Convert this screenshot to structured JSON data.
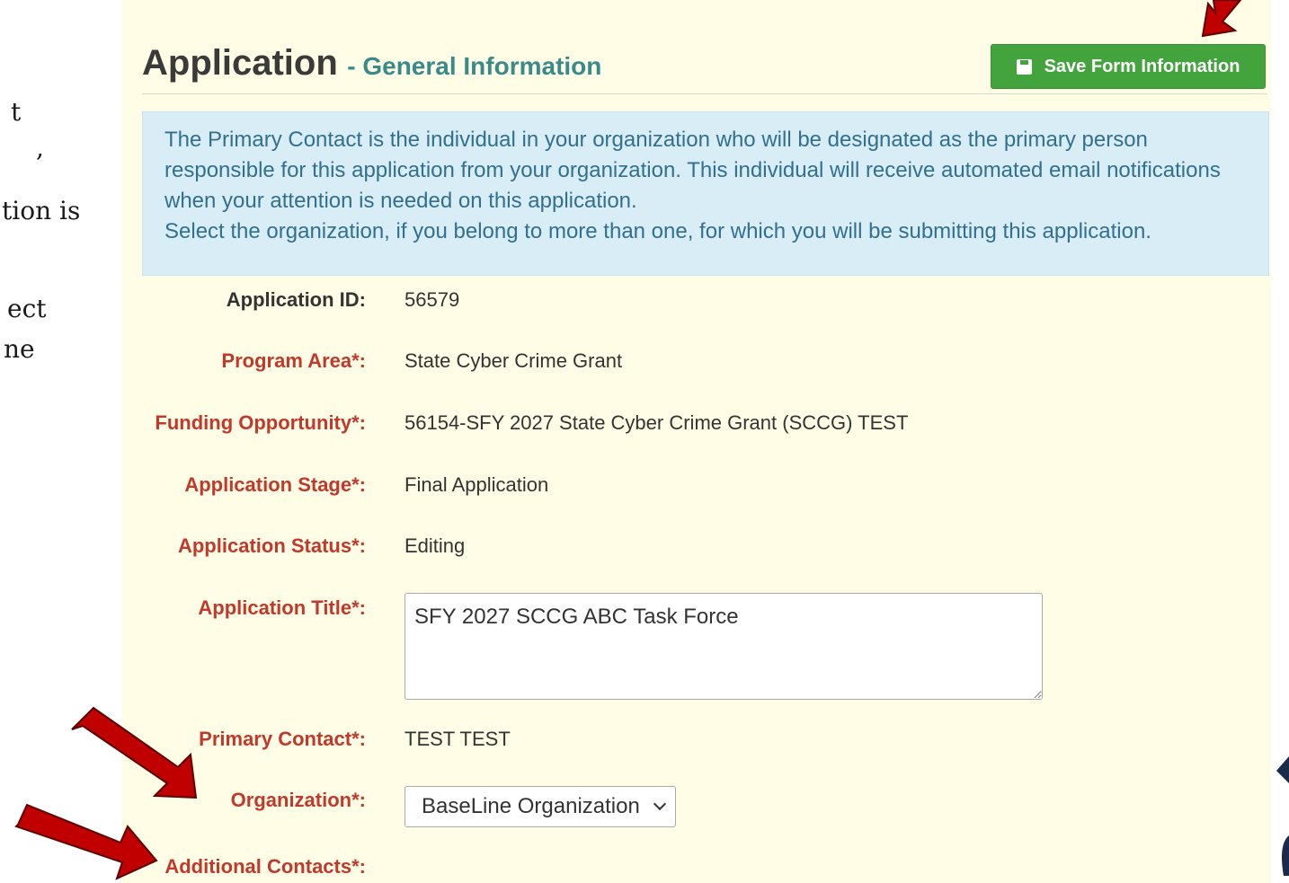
{
  "slide_fragments": [
    "t",
    ",",
    "tion is",
    "ect",
    "ne"
  ],
  "header": {
    "title": "Application",
    "subtitle": "- General Information",
    "save_label": "Save Form Information",
    "save_icon": "floppy-disk-icon"
  },
  "info": {
    "paragraph": "The Primary Contact is the individual in your organization who will be designated as the primary person responsible for this application from your organization. This individual will receive automated email notifications when your attention is needed on this application.",
    "paragraph2": "Select the organization, if you belong to more than one, for which you will be submitting this application."
  },
  "fields": {
    "application_id": {
      "label": "Application ID:",
      "value": "56579"
    },
    "program_area": {
      "label": "Program Area*:",
      "value": "State Cyber Crime Grant"
    },
    "funding_opportunity": {
      "label": "Funding Opportunity*:",
      "value": "56154-SFY 2027 State Cyber Crime Grant (SCCG) TEST"
    },
    "application_stage": {
      "label": "Application Stage*:",
      "value": "Final Application"
    },
    "application_status": {
      "label": "Application Status*:",
      "value": "Editing"
    },
    "application_title": {
      "label": "Application Title*:",
      "value": "SFY 2027 SCCG ABC Task Force"
    },
    "primary_contact": {
      "label": "Primary Contact*:",
      "value": "TEST TEST"
    },
    "organization": {
      "label": "Organization*:",
      "value": "BaseLine Organization"
    },
    "additional_contacts": {
      "label": "Additional Contacts*:"
    }
  },
  "colors": {
    "panel_bg": "#fffde6",
    "info_bg": "#d9edf7",
    "required_label": "#c0392b",
    "button_green": "#43a43d",
    "arrow_red": "#c00000"
  }
}
